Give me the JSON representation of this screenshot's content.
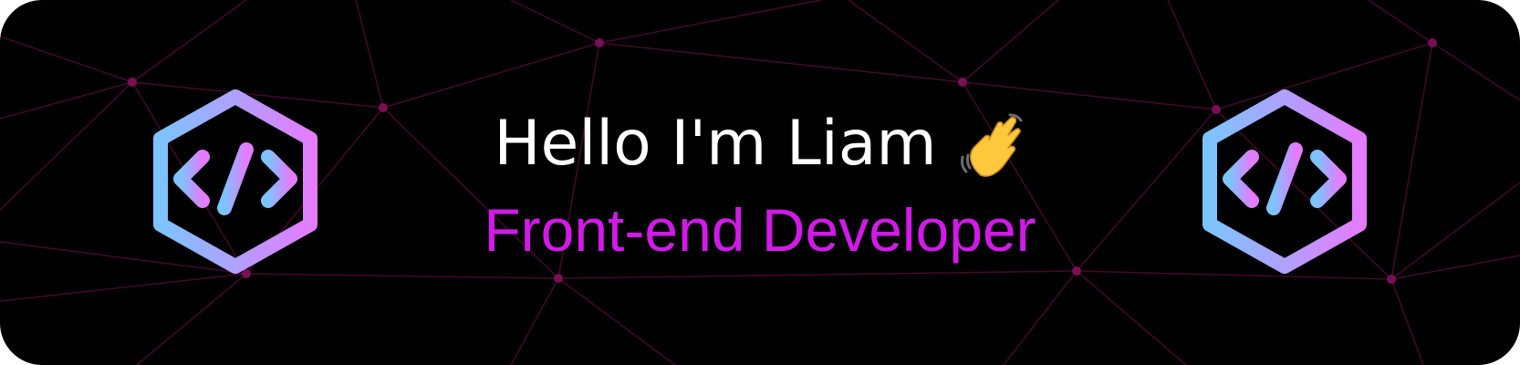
{
  "banner": {
    "greeting": "Hello I'm Liam",
    "role": "Front-end Developer"
  },
  "icons": {
    "left_logo": "code-hexagon-icon",
    "right_logo": "code-hexagon-icon",
    "emoji": "waving-hand-icon"
  },
  "colors": {
    "background": "#000000",
    "mesh_line": "#4a0a33",
    "mesh_node": "#7a0f52",
    "greeting_text": "#ffffff",
    "role_text": "#d21ae8",
    "logo_gradient_start": "#7cc4ff",
    "logo_gradient_end": "#e47cff"
  }
}
